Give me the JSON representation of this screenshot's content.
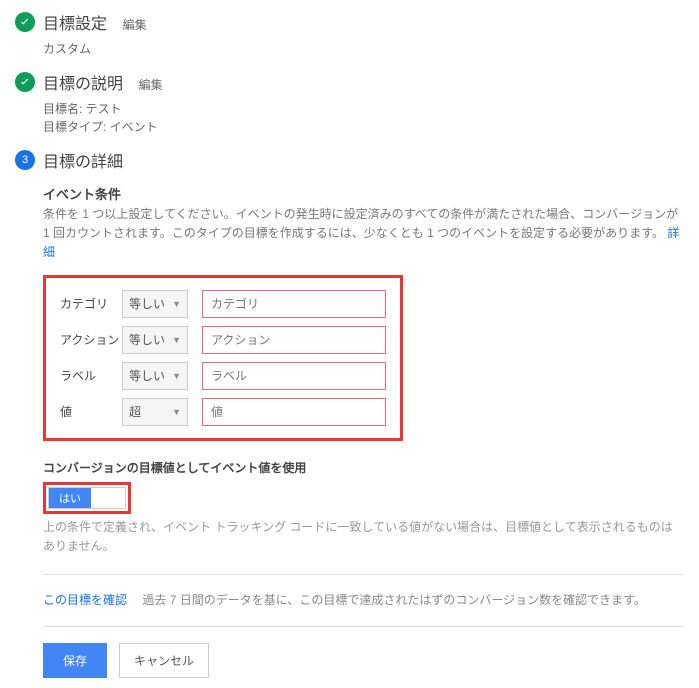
{
  "steps": {
    "s1": {
      "title": "目標設定",
      "edit": "編集",
      "sub": "カスタム"
    },
    "s2": {
      "title": "目標の説明",
      "edit": "編集",
      "name_line": "目標名: テスト",
      "type_line": "目標タイプ: イベント"
    },
    "s3": {
      "number": "3",
      "title": "目標の詳細"
    }
  },
  "event": {
    "heading": "イベント条件",
    "desc": "条件を 1 つ以上設定してください。イベントの発生時に設定済みのすべての条件が満たされた場合、コンバージョンが 1 回カウントされます。このタイプの目標を作成するには、少なくとも 1 つのイベントを設定する必要があります。",
    "details_link": "詳細",
    "rows": [
      {
        "label": "カテゴリ",
        "op": "等しい",
        "ph": "カテゴリ"
      },
      {
        "label": "アクション",
        "op": "等しい",
        "ph": "アクション"
      },
      {
        "label": "ラベル",
        "op": "等しい",
        "ph": "ラベル"
      },
      {
        "label": "値",
        "op": "超",
        "ph": "値"
      }
    ]
  },
  "value": {
    "heading": "コンバージョンの目標値としてイベント値を使用",
    "toggle_on": "はい",
    "note": "上の条件で定義され、イベント トラッキング コードに一致している値がない場合は、目標値として表示されるものはありません。"
  },
  "verify": {
    "link": "この目標を確認",
    "desc": "過去 7 日間のデータを基に、この目標で達成されたはずのコンバージョン数を確認できます。"
  },
  "buttons": {
    "save": "保存",
    "cancel": "キャンセル"
  }
}
